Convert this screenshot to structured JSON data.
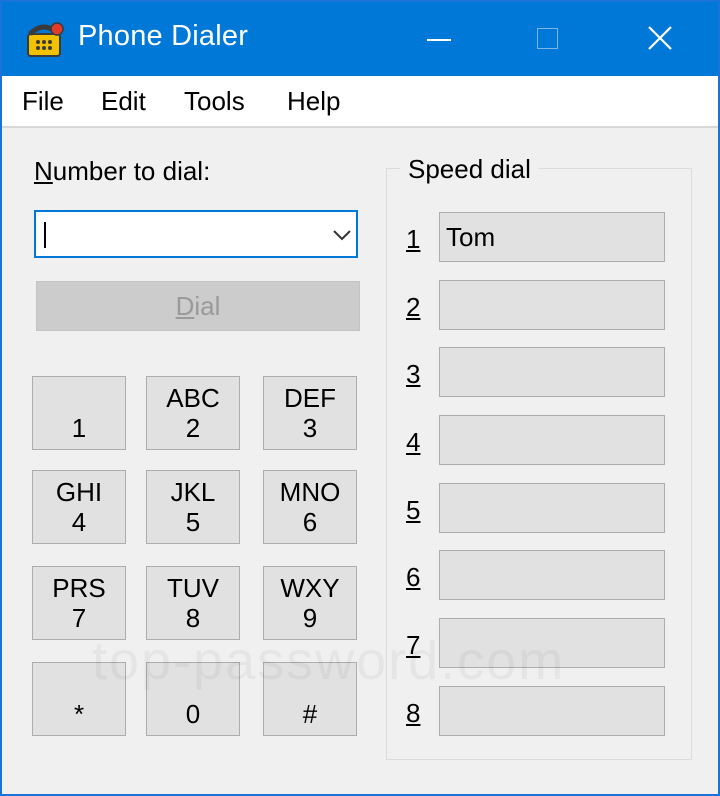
{
  "window": {
    "title": "Phone Dialer"
  },
  "menu": [
    "File",
    "Edit",
    "Tools",
    "Help"
  ],
  "number_label": {
    "mnemonic": "N",
    "rest": "umber to dial:"
  },
  "number_input": {
    "value": ""
  },
  "dial_button": {
    "mnemonic": "D",
    "rest": "ial"
  },
  "keypad": [
    {
      "letters": "",
      "digit": "1"
    },
    {
      "letters": "ABC",
      "digit": "2"
    },
    {
      "letters": "DEF",
      "digit": "3"
    },
    {
      "letters": "GHI",
      "digit": "4"
    },
    {
      "letters": "JKL",
      "digit": "5"
    },
    {
      "letters": "MNO",
      "digit": "6"
    },
    {
      "letters": "PRS",
      "digit": "7"
    },
    {
      "letters": "TUV",
      "digit": "8"
    },
    {
      "letters": "WXY",
      "digit": "9"
    },
    {
      "letters": "",
      "digit": "*"
    },
    {
      "letters": "",
      "digit": "0"
    },
    {
      "letters": "",
      "digit": "#"
    }
  ],
  "speed_dial": {
    "title": "Speed dial",
    "entries": [
      {
        "num": "1",
        "name": "Tom"
      },
      {
        "num": "2",
        "name": ""
      },
      {
        "num": "3",
        "name": ""
      },
      {
        "num": "4",
        "name": ""
      },
      {
        "num": "5",
        "name": ""
      },
      {
        "num": "6",
        "name": ""
      },
      {
        "num": "7",
        "name": ""
      },
      {
        "num": "8",
        "name": ""
      }
    ]
  },
  "watermark": "top-password.com",
  "colors": {
    "titlebar": "#0078d7",
    "window_bg": "#f0f0f0",
    "button_bg": "#e1e1e1"
  }
}
